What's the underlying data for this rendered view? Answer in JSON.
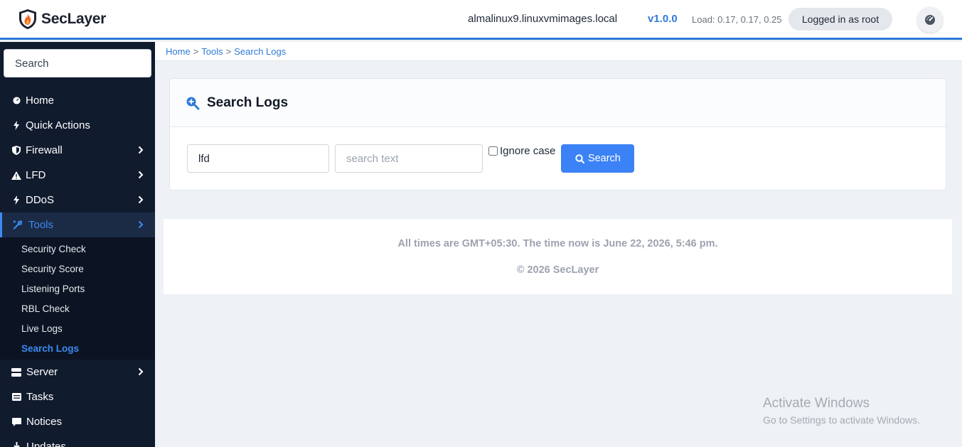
{
  "app": {
    "name": "SecLayer"
  },
  "header": {
    "hostname": "almalinux9.linuxvmimages.local",
    "version": "v1.0.0",
    "load": "Load: 0.17, 0.17, 0.25",
    "user_badge": "Logged in as root",
    "gauge_icon": "gauge-icon"
  },
  "sidebar": {
    "search_placeholder": "Search",
    "items": [
      {
        "label": "Home",
        "icon": "dashboard-icon"
      },
      {
        "label": "Quick Actions",
        "icon": "bolt-icon"
      },
      {
        "label": "Firewall",
        "icon": "shield-icon"
      },
      {
        "label": "LFD",
        "icon": "warning-icon"
      },
      {
        "label": "DDoS",
        "icon": "bolt-icon"
      },
      {
        "label": "Tools",
        "icon": "tools-icon"
      },
      {
        "label": "Server",
        "icon": "server-icon"
      },
      {
        "label": "Tasks",
        "icon": "list-icon"
      },
      {
        "label": "Notices",
        "icon": "comment-icon"
      },
      {
        "label": "Updates",
        "icon": "download-icon"
      }
    ],
    "tools_sub": [
      "Security Check",
      "Security Score",
      "Listening Ports",
      "RBL Check",
      "Live Logs",
      "Search Logs"
    ]
  },
  "breadcrumb": {
    "home": "Home",
    "tools": "Tools",
    "current": "Search Logs",
    "separator": ">"
  },
  "card": {
    "title": "Search Logs",
    "file_value": "lfd",
    "search_placeholder": "search text",
    "ignore_case_label": "Ignore case",
    "search_button": "Search"
  },
  "footer": {
    "time_text": "All times are GMT+05:30. The time now is June 22, 2026, 5:46 pm.",
    "copyright": "© 2026 SecLayer"
  },
  "watermark": {
    "title": "Activate Windows",
    "subtitle": "Go to Settings to activate Windows."
  },
  "colors": {
    "accent": "#3b82f6",
    "sidebar_bg": "#111b2e",
    "active_link": "#3b8bf0"
  }
}
